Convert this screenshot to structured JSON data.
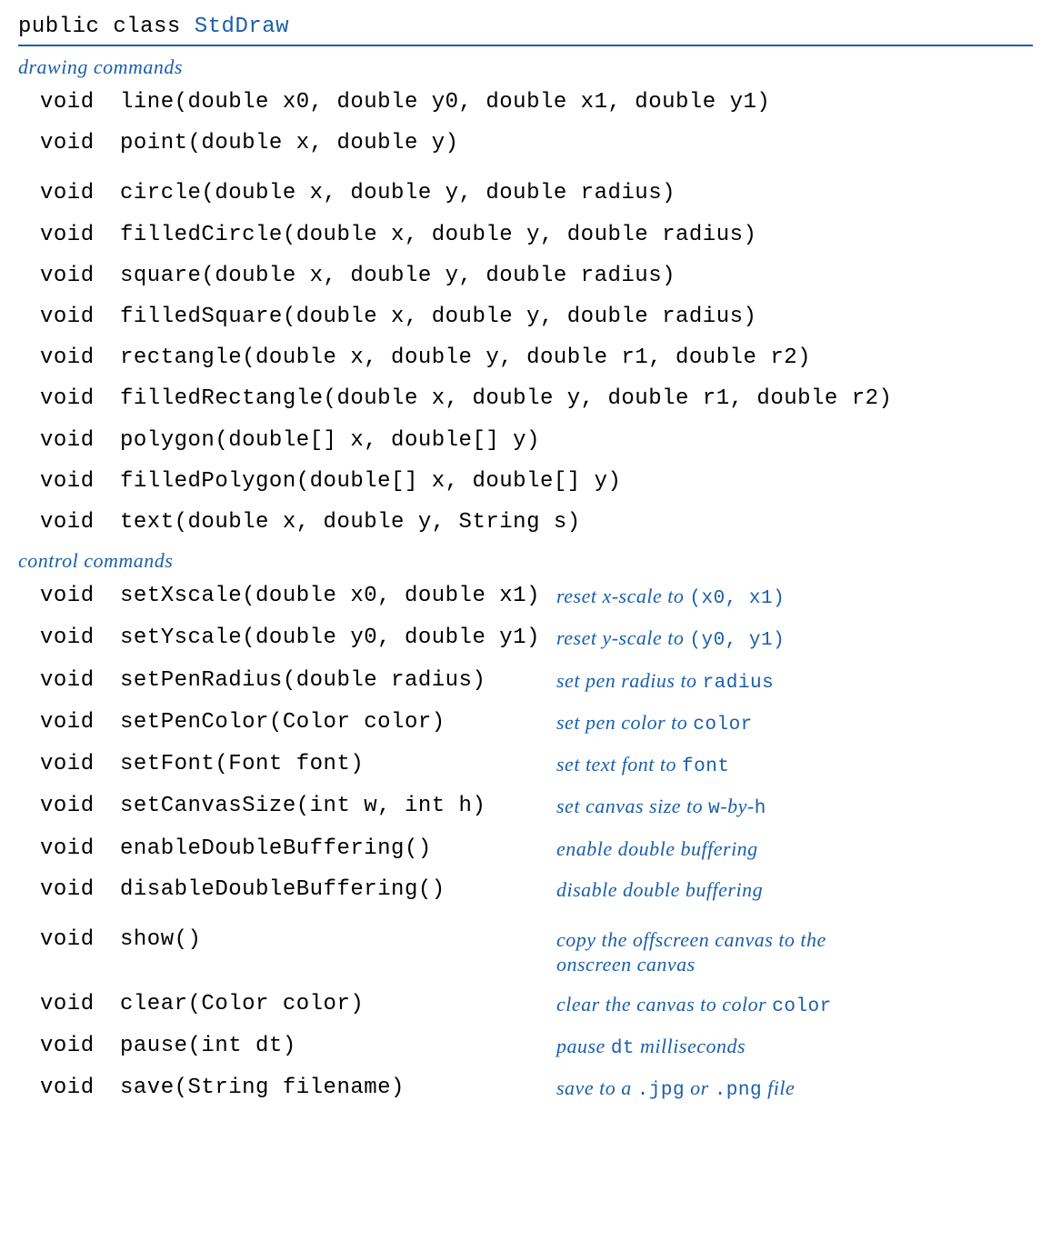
{
  "header": {
    "keywords": "public class ",
    "class_name": "StdDraw"
  },
  "sections": {
    "drawing": {
      "label": "drawing commands",
      "methods": [
        {
          "ret": "void",
          "sig": "line(double x0, double y0, double x1, double y1)"
        },
        {
          "ret": "void",
          "sig": "point(double x, double y)"
        },
        {
          "ret": "void",
          "sig": "circle(double x, double y, double radius)"
        },
        {
          "ret": "void",
          "sig": "filledCircle(double x, double y, double radius)"
        },
        {
          "ret": "void",
          "sig": "square(double x, double y, double radius)"
        },
        {
          "ret": "void",
          "sig": "filledSquare(double x, double y, double radius)"
        },
        {
          "ret": "void",
          "sig": "rectangle(double x, double y, double r1, double r2)"
        },
        {
          "ret": "void",
          "sig": "filledRectangle(double x, double y, double r1, double r2)"
        },
        {
          "ret": "void",
          "sig": "polygon(double[] x, double[] y)"
        },
        {
          "ret": "void",
          "sig": "filledPolygon(double[] x, double[] y)"
        },
        {
          "ret": "void",
          "sig": "text(double x, double y, String s)"
        }
      ]
    },
    "control": {
      "label": "control commands",
      "methods": [
        {
          "ret": "void",
          "sig": "setXscale(double x0, double x1)",
          "desc_parts": [
            {
              "t": "reset x-scale to "
            },
            {
              "c": "(x0, x1)"
            }
          ]
        },
        {
          "ret": "void",
          "sig": "setYscale(double y0, double y1)",
          "desc_parts": [
            {
              "t": "reset y-scale to "
            },
            {
              "c": "(y0, y1)"
            }
          ]
        },
        {
          "ret": "void",
          "sig": "setPenRadius(double radius)",
          "desc_parts": [
            {
              "t": "set pen radius to "
            },
            {
              "c": "radius"
            }
          ]
        },
        {
          "ret": "void",
          "sig": "setPenColor(Color color)",
          "desc_parts": [
            {
              "t": "set pen color to "
            },
            {
              "c": "color"
            }
          ]
        },
        {
          "ret": "void",
          "sig": "setFont(Font font)",
          "desc_parts": [
            {
              "t": "set text font to "
            },
            {
              "c": "font"
            }
          ]
        },
        {
          "ret": "void",
          "sig": "setCanvasSize(int w, int h)",
          "desc_parts": [
            {
              "t": "set canvas size to "
            },
            {
              "c": "w"
            },
            {
              "t": "-by-"
            },
            {
              "c": "h"
            }
          ]
        },
        {
          "ret": "void",
          "sig": "enableDoubleBuffering()",
          "desc_parts": [
            {
              "t": "enable double buffering"
            }
          ]
        },
        {
          "ret": "void",
          "sig": "disableDoubleBuffering()",
          "desc_parts": [
            {
              "t": "disable double buffering"
            }
          ]
        },
        {
          "ret": "void",
          "sig": "show()",
          "desc_parts": [
            {
              "t": "copy the offscreen canvas to the onscreen canvas"
            }
          ]
        },
        {
          "ret": "void",
          "sig": "clear(Color color)",
          "desc_parts": [
            {
              "t": "clear the canvas to color "
            },
            {
              "c": "color"
            }
          ]
        },
        {
          "ret": "void",
          "sig": "pause(int dt)",
          "desc_parts": [
            {
              "t": "pause "
            },
            {
              "c": "dt"
            },
            {
              "t": " milliseconds"
            }
          ]
        },
        {
          "ret": "void",
          "sig": "save(String filename)",
          "desc_parts": [
            {
              "t": "save to a "
            },
            {
              "c": ".jpg"
            },
            {
              "t": " or "
            },
            {
              "c": ".png"
            },
            {
              "t": " file"
            }
          ]
        }
      ]
    }
  }
}
